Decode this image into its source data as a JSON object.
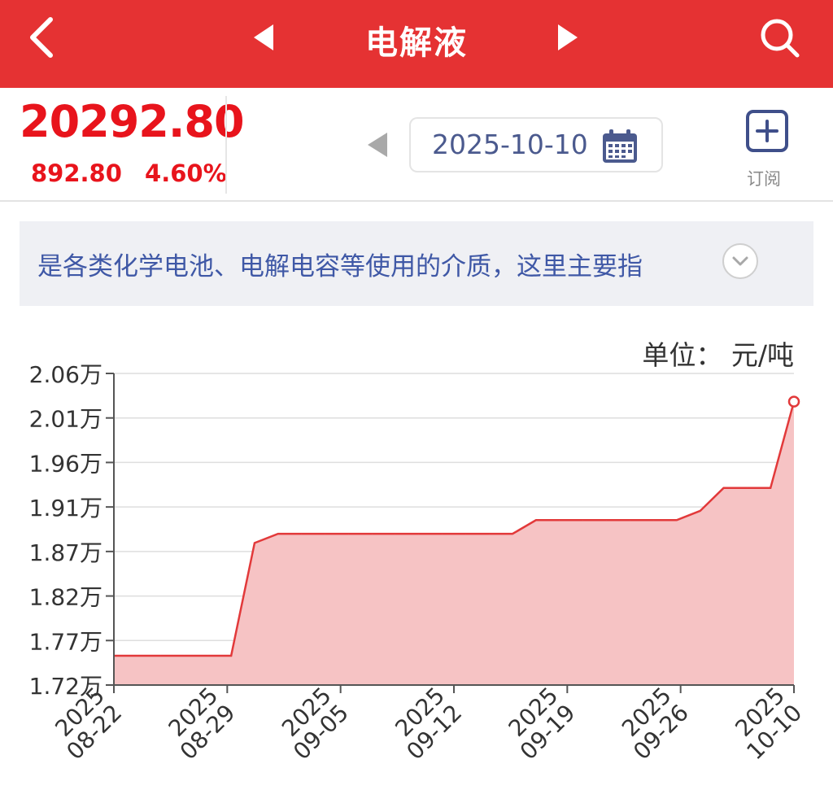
{
  "header": {
    "title": "电解液"
  },
  "quote": {
    "price": "20292.80",
    "change": "892.80",
    "change_pct": "4.60%"
  },
  "date_picker": {
    "date": "2025-10-10"
  },
  "subscribe": {
    "label": "订阅"
  },
  "description": {
    "text": "是各类化学电池、电解电容等使用的介质，这里主要指"
  },
  "chart_unit": "单位： 元/吨",
  "colors": {
    "brand_red": "#e53233",
    "price_red": "#e8141c",
    "line_red": "#e2393a",
    "area_fill": "#f6c3c4",
    "link_blue": "#3f58a6"
  },
  "chart_data": {
    "type": "area",
    "title": "",
    "xlabel": "",
    "ylabel": "",
    "y_tick_labels": [
      "2.06万",
      "2.01万",
      "1.96万",
      "1.91万",
      "1.87万",
      "1.82万",
      "1.77万",
      "1.72万"
    ],
    "ylim": [
      17200,
      20600
    ],
    "x_tick_labels": [
      [
        "2025",
        "08-22"
      ],
      [
        "2025",
        "08-29"
      ],
      [
        "2025",
        "09-05"
      ],
      [
        "2025",
        "09-12"
      ],
      [
        "2025",
        "09-19"
      ],
      [
        "2025",
        "09-26"
      ],
      [
        "2025",
        "10-10"
      ]
    ],
    "x": [
      "2025-08-22",
      "2025-08-25",
      "2025-08-26",
      "2025-08-27",
      "2025-08-28",
      "2025-08-29",
      "2025-09-01",
      "2025-09-02",
      "2025-09-03",
      "2025-09-04",
      "2025-09-05",
      "2025-09-08",
      "2025-09-09",
      "2025-09-10",
      "2025-09-11",
      "2025-09-12",
      "2025-09-15",
      "2025-09-16",
      "2025-09-17",
      "2025-09-18",
      "2025-09-19",
      "2025-09-22",
      "2025-09-23",
      "2025-09-24",
      "2025-09-25",
      "2025-09-26",
      "2025-09-29",
      "2025-09-30",
      "2025-10-09",
      "2025-10-10"
    ],
    "values": [
      17520,
      17520,
      17520,
      17520,
      17520,
      17520,
      18750,
      18850,
      18850,
      18850,
      18850,
      18850,
      18850,
      18850,
      18850,
      18850,
      18850,
      18850,
      19000,
      19000,
      19000,
      19000,
      19000,
      19000,
      19000,
      19100,
      19350,
      19350,
      19350,
      20293
    ],
    "last_point_marker": true,
    "grid": true
  }
}
